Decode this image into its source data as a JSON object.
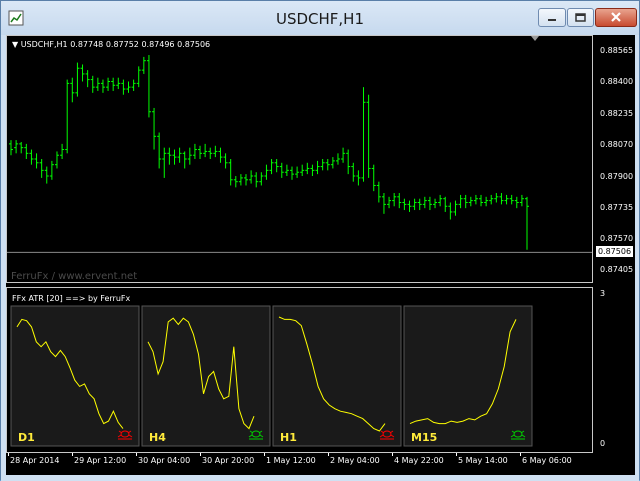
{
  "window": {
    "title": "USDCHF,H1"
  },
  "chart": {
    "symbol_line": "USDCHF,H1  0.87748 0.87752 0.87496 0.87506",
    "watermark": "FerruFx / www.ervent.net",
    "current_price": "0.87506",
    "price_labels": [
      "0.88565",
      "0.88400",
      "0.88235",
      "0.88070",
      "0.87900",
      "0.87735",
      "0.87570",
      "0.87405"
    ],
    "candles": [
      [
        0.8808,
        0.8805,
        0.881,
        0.8802
      ],
      [
        0.8806,
        0.8808,
        0.881,
        0.8803
      ],
      [
        0.8808,
        0.8806,
        0.8809,
        0.8803
      ],
      [
        0.8806,
        0.8803,
        0.8808,
        0.88
      ],
      [
        0.8803,
        0.88,
        0.8805,
        0.8797
      ],
      [
        0.88,
        0.8798,
        0.8803,
        0.8795
      ],
      [
        0.8798,
        0.8794,
        0.88,
        0.879
      ],
      [
        0.8794,
        0.8791,
        0.8796,
        0.8787
      ],
      [
        0.8791,
        0.8797,
        0.8799,
        0.8789
      ],
      [
        0.8797,
        0.8802,
        0.8804,
        0.8795
      ],
      [
        0.8802,
        0.8805,
        0.8808,
        0.88
      ],
      [
        0.8805,
        0.884,
        0.8842,
        0.8803
      ],
      [
        0.884,
        0.8835,
        0.8843,
        0.883
      ],
      [
        0.8835,
        0.8848,
        0.8851,
        0.8833
      ],
      [
        0.8848,
        0.8845,
        0.885,
        0.8841
      ],
      [
        0.8845,
        0.8842,
        0.8847,
        0.8838
      ],
      [
        0.8842,
        0.8838,
        0.8844,
        0.8835
      ],
      [
        0.8838,
        0.884,
        0.8843,
        0.8836
      ],
      [
        0.884,
        0.8838,
        0.8842,
        0.8835
      ],
      [
        0.8838,
        0.8841,
        0.8843,
        0.8836
      ],
      [
        0.8841,
        0.8839,
        0.8843,
        0.8836
      ],
      [
        0.8839,
        0.884,
        0.8843,
        0.8837
      ],
      [
        0.884,
        0.8837,
        0.8842,
        0.8834
      ],
      [
        0.8837,
        0.8838,
        0.8841,
        0.8835
      ],
      [
        0.8838,
        0.884,
        0.8842,
        0.8836
      ],
      [
        0.884,
        0.8847,
        0.8849,
        0.8838
      ],
      [
        0.8847,
        0.8852,
        0.8854,
        0.8845
      ],
      [
        0.8852,
        0.8825,
        0.8855,
        0.8822
      ],
      [
        0.8825,
        0.8812,
        0.8827,
        0.8805
      ],
      [
        0.8812,
        0.88,
        0.8814,
        0.8795
      ],
      [
        0.88,
        0.8803,
        0.8806,
        0.879
      ],
      [
        0.8803,
        0.8802,
        0.8806,
        0.8797
      ],
      [
        0.8802,
        0.8801,
        0.8805,
        0.8797
      ],
      [
        0.8801,
        0.8803,
        0.8806,
        0.8798
      ],
      [
        0.8803,
        0.88,
        0.8804,
        0.8795
      ],
      [
        0.88,
        0.8802,
        0.8806,
        0.8797
      ],
      [
        0.8802,
        0.8805,
        0.8808,
        0.88
      ],
      [
        0.8805,
        0.8803,
        0.8807,
        0.88
      ],
      [
        0.8803,
        0.8804,
        0.8808,
        0.8801
      ],
      [
        0.8804,
        0.8803,
        0.8806,
        0.88
      ],
      [
        0.8803,
        0.8804,
        0.8807,
        0.8801
      ],
      [
        0.8804,
        0.8801,
        0.8806,
        0.8798
      ],
      [
        0.8801,
        0.8798,
        0.8803,
        0.8795
      ],
      [
        0.8798,
        0.8789,
        0.88,
        0.8786
      ],
      [
        0.8789,
        0.8788,
        0.8791,
        0.8785
      ],
      [
        0.8788,
        0.879,
        0.8792,
        0.8786
      ],
      [
        0.879,
        0.8789,
        0.8792,
        0.8786
      ],
      [
        0.8789,
        0.8791,
        0.8794,
        0.8787
      ],
      [
        0.8791,
        0.8788,
        0.8793,
        0.8785
      ],
      [
        0.8788,
        0.8791,
        0.8793,
        0.8786
      ],
      [
        0.8791,
        0.8794,
        0.8797,
        0.8789
      ],
      [
        0.8794,
        0.8798,
        0.88,
        0.8792
      ],
      [
        0.8798,
        0.8796,
        0.88,
        0.8793
      ],
      [
        0.8796,
        0.8793,
        0.8798,
        0.879
      ],
      [
        0.8793,
        0.8794,
        0.8797,
        0.8791
      ],
      [
        0.8794,
        0.8792,
        0.8796,
        0.8789
      ],
      [
        0.8792,
        0.8793,
        0.8796,
        0.879
      ],
      [
        0.8793,
        0.8794,
        0.8797,
        0.8791
      ],
      [
        0.8794,
        0.8795,
        0.8798,
        0.8792
      ],
      [
        0.8795,
        0.8794,
        0.8797,
        0.8791
      ],
      [
        0.8794,
        0.8796,
        0.8799,
        0.8792
      ],
      [
        0.8796,
        0.8798,
        0.88,
        0.8794
      ],
      [
        0.8798,
        0.8797,
        0.88,
        0.8794
      ],
      [
        0.8797,
        0.8799,
        0.8801,
        0.8795
      ],
      [
        0.8799,
        0.88,
        0.8803,
        0.8797
      ],
      [
        0.88,
        0.8803,
        0.8806,
        0.8798
      ],
      [
        0.8803,
        0.8796,
        0.8805,
        0.8792
      ],
      [
        0.8796,
        0.8791,
        0.8798,
        0.8788
      ],
      [
        0.8791,
        0.879,
        0.8794,
        0.8786
      ],
      [
        0.879,
        0.883,
        0.8838,
        0.8788
      ],
      [
        0.883,
        0.8795,
        0.8834,
        0.879
      ],
      [
        0.8795,
        0.8786,
        0.8797,
        0.8783
      ],
      [
        0.8786,
        0.878,
        0.8788,
        0.8777
      ],
      [
        0.878,
        0.8776,
        0.8782,
        0.8771
      ],
      [
        0.8776,
        0.8778,
        0.878,
        0.8774
      ],
      [
        0.8778,
        0.878,
        0.8782,
        0.8775
      ],
      [
        0.878,
        0.8777,
        0.8782,
        0.8774
      ],
      [
        0.8777,
        0.8776,
        0.8779,
        0.8773
      ],
      [
        0.8776,
        0.8775,
        0.8778,
        0.8772
      ],
      [
        0.8775,
        0.8777,
        0.8779,
        0.8773
      ],
      [
        0.8777,
        0.8776,
        0.8779,
        0.8773
      ],
      [
        0.8776,
        0.8778,
        0.878,
        0.8774
      ],
      [
        0.8778,
        0.8776,
        0.878,
        0.8773
      ],
      [
        0.8776,
        0.8777,
        0.8779,
        0.8774
      ],
      [
        0.8777,
        0.8779,
        0.8781,
        0.8775
      ],
      [
        0.8779,
        0.8775,
        0.878,
        0.8772
      ],
      [
        0.8775,
        0.8772,
        0.8777,
        0.8768
      ],
      [
        0.8772,
        0.8776,
        0.8778,
        0.877
      ],
      [
        0.8776,
        0.8779,
        0.8781,
        0.8774
      ],
      [
        0.8779,
        0.8777,
        0.8781,
        0.8774
      ],
      [
        0.8777,
        0.8778,
        0.878,
        0.8775
      ],
      [
        0.8778,
        0.8779,
        0.8781,
        0.8776
      ],
      [
        0.8779,
        0.8777,
        0.8781,
        0.8775
      ],
      [
        0.8777,
        0.8778,
        0.878,
        0.8775
      ],
      [
        0.8778,
        0.8779,
        0.8781,
        0.8776
      ],
      [
        0.8779,
        0.878,
        0.8782,
        0.8777
      ],
      [
        0.878,
        0.8778,
        0.8782,
        0.8776
      ],
      [
        0.8778,
        0.8779,
        0.8781,
        0.8776
      ],
      [
        0.8779,
        0.8778,
        0.8781,
        0.8776
      ],
      [
        0.8778,
        0.8777,
        0.878,
        0.8774
      ],
      [
        0.8777,
        0.8779,
        0.8781,
        0.8775
      ],
      [
        0.8779,
        0.8775,
        0.878,
        0.8752
      ]
    ],
    "ylim": [
      0.8736,
      0.8864
    ]
  },
  "indicator": {
    "label": "FFx ATR [20] ==> by FerruFx",
    "scale_max": "3",
    "scale_min": "0",
    "panels": [
      {
        "tf": "D1",
        "signal": "red",
        "series": [
          0.88,
          0.94,
          0.93,
          0.88,
          0.76,
          0.72,
          0.76,
          0.68,
          0.64,
          0.69,
          0.64,
          0.55,
          0.45,
          0.4,
          0.42,
          0.34,
          0.3,
          0.18,
          0.1,
          0.12,
          0.2,
          0.11,
          0.06
        ]
      },
      {
        "tf": "H4",
        "signal": "green",
        "series": [
          0.76,
          0.68,
          0.5,
          0.6,
          0.92,
          0.95,
          0.9,
          0.95,
          0.92,
          0.82,
          0.66,
          0.34,
          0.48,
          0.52,
          0.38,
          0.3,
          0.32,
          0.72,
          0.22,
          0.1,
          0.06,
          0.16
        ]
      },
      {
        "tf": "H1",
        "signal": "red",
        "series": [
          0.96,
          0.94,
          0.94,
          0.93,
          0.89,
          0.74,
          0.58,
          0.4,
          0.3,
          0.25,
          0.22,
          0.2,
          0.19,
          0.18,
          0.16,
          0.14,
          0.1,
          0.06,
          0.04,
          0.1
        ]
      },
      {
        "tf": "M15",
        "signal": "green",
        "series": [
          0.1,
          0.12,
          0.13,
          0.14,
          0.11,
          0.1,
          0.1,
          0.12,
          0.11,
          0.12,
          0.14,
          0.13,
          0.16,
          0.18,
          0.26,
          0.38,
          0.56,
          0.84,
          0.94
        ]
      }
    ]
  },
  "time_labels": [
    "28 Apr 2014",
    "29 Apr 12:00",
    "30 Apr 04:00",
    "30 Apr 20:00",
    "1 May 12:00",
    "2 May 04:00",
    "4 May 22:00",
    "5 May 14:00",
    "6 May 06:00"
  ],
  "colors": {
    "bull": "#00ff00",
    "bear": "#00ff00",
    "atr_line": "#ffff00",
    "signal_red": "#ff0000",
    "signal_green": "#00d000"
  },
  "icons": {
    "app": "chart-icon",
    "minimize": "minimize-icon",
    "maximize": "maximize-icon",
    "close": "close-icon",
    "signal": "bug-icon"
  }
}
